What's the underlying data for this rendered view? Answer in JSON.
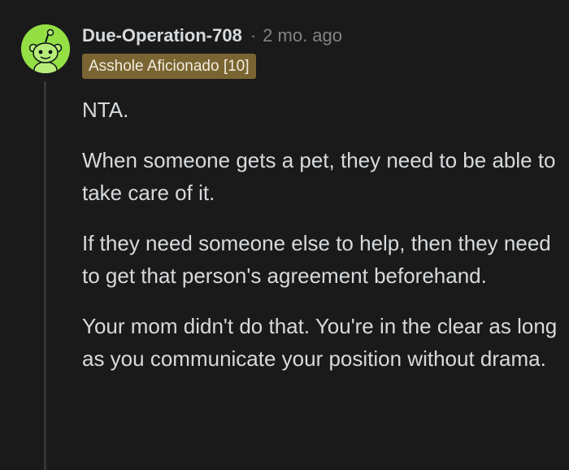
{
  "comment": {
    "username": "Due-Operation-708",
    "separator": "·",
    "timestamp": "2 mo. ago",
    "flair": "Asshole Aficionado [10]",
    "avatar_color": "#94e044",
    "paragraphs": [
      "NTA.",
      "When someone gets a pet, they need to be able to take care of it.",
      "If they need someone else to help, then they need to get that person's agreement beforehand.",
      "Your mom didn't do that. You're in the clear as long as you communicate your position without drama."
    ]
  }
}
